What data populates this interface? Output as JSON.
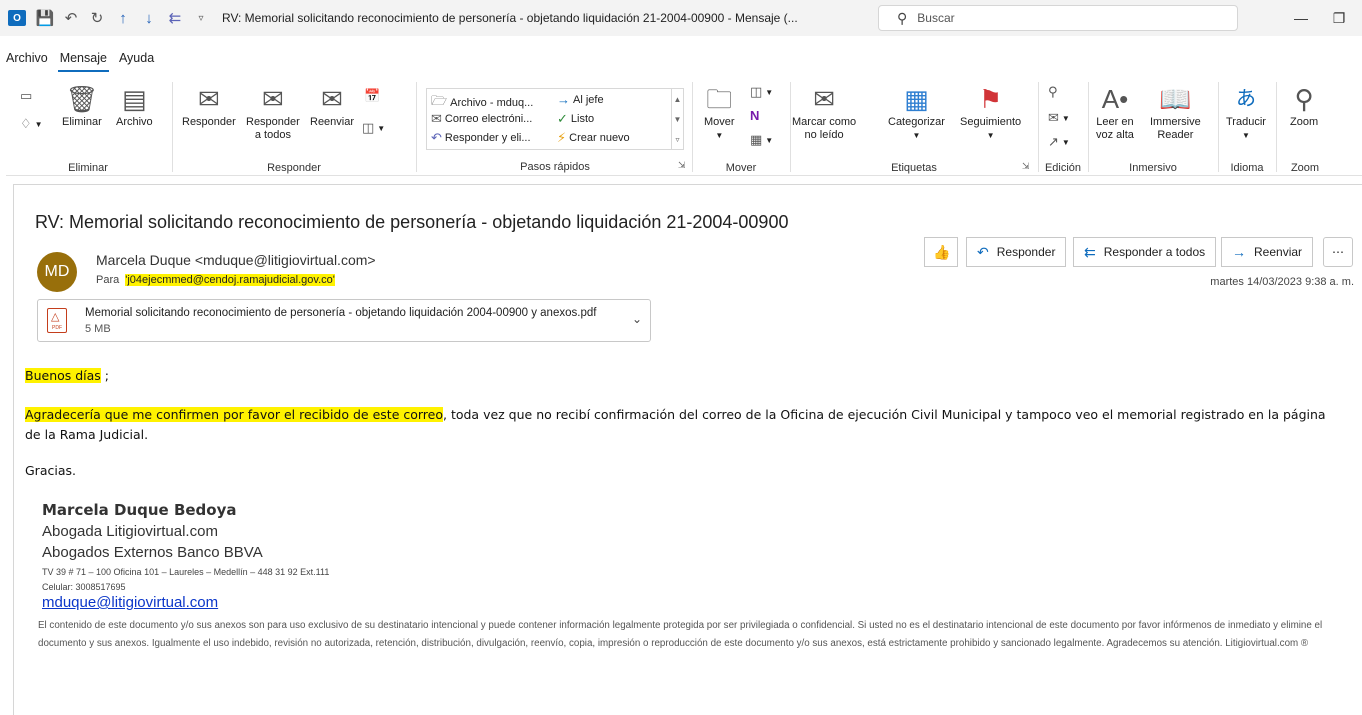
{
  "titlebar": {
    "app_icon": "O",
    "title": "RV: Memorial solicitando reconocimiento de personería - objetando liquidación 21-2004-00900  -  Mensaje (...",
    "search_placeholder": "Buscar"
  },
  "menu": [
    "Archivo",
    "Mensaje",
    "Ayuda"
  ],
  "ribbon": {
    "eliminar": {
      "label": "Eliminar",
      "eliminar_btn": "Eliminar",
      "archivo_btn": "Archivo"
    },
    "responder": {
      "label": "Responder",
      "responder_btn": "Responder",
      "responder_todos_1": "Responder",
      "responder_todos_2": "a todos",
      "reenviar_btn": "Reenviar"
    },
    "pasos": {
      "label": "Pasos rápidos",
      "items": [
        "Archivo - mduq...",
        "Al jefe",
        "Correo electróni...",
        "Listo",
        "Responder y eli...",
        "Crear nuevo"
      ]
    },
    "mover": {
      "label": "Mover",
      "mover_btn": "Mover"
    },
    "etiquetas": {
      "label": "Etiquetas",
      "marcar_1": "Marcar como",
      "marcar_2": "no leído",
      "categorizar": "Categorizar",
      "seguimiento": "Seguimiento"
    },
    "edicion": {
      "label": "Edición"
    },
    "inmersivo": {
      "label": "Inmersivo",
      "leer_1": "Leer en",
      "leer_2": "voz alta",
      "immersive_1": "Immersive",
      "immersive_2": "Reader"
    },
    "idioma": {
      "label": "Idioma",
      "traducir": "Traducir"
    },
    "zoom": {
      "label": "Zoom",
      "zoom_btn": "Zoom"
    }
  },
  "message": {
    "subject": "RV: Memorial solicitando reconocimiento de personería - objetando liquidación 21-2004-00900",
    "avatar_initials": "MD",
    "sender": "Marcela Duque <mduque@litigiovirtual.com>",
    "to_label": "Para",
    "to_value": "'j04ejecmmed@cendoj.ramajudicial.gov.co'",
    "date": "martes 14/03/2023 9:38 a. m.",
    "actions": {
      "responder": "Responder",
      "responder_todos": "Responder a todos",
      "reenviar": "Reenviar"
    },
    "attachment": {
      "name": "Memorial solicitando reconocimiento de personería - objetando liquidación 2004-00900 y anexos.pdf",
      "size": "5 MB",
      "type": "PDF"
    },
    "body": {
      "greeting_hl": "Buenos días",
      "greeting_rest": " ;",
      "p2_hl": "Agradecería que me confirmen por favor el recibido de este correo",
      "p2_rest": ", toda vez que no recibí confirmación del correo de la Oficina de ejecución Civil Municipal y tampoco veo el memorial registrado en la página de la Rama Judicial.",
      "thanks": "Gracias."
    },
    "signature": {
      "name": "Marcela Duque Bedoya",
      "line1": "Abogada Litigiovirtual.com",
      "line2": "Abogados Externos Banco BBVA",
      "address": "TV 39 # 71 – 100 Oficina 101 – Laureles – Medellín – 448 31 92 Ext.111",
      "phone": "Celular: 3008517695",
      "email": "mduque@litigiovirtual.com",
      "disclaimer": "El contenido de este documento y/o sus anexos son para uso exclusivo de su destinatario intencional y puede contener información legalmente protegida por ser privilegiada o confidencial. Si usted no es el destinatario intencional de este documento por favor infórmenos de inmediato y elimine el documento y sus anexos. Igualmente el uso indebido, revisión no autorizada, retención, distribución, divulgación, reenvío, copia, impresión o reproducción de este documento y/o sus anexos, está estrictamente prohibido y sancionado legalmente. Agradecemos su atención. Litigiovirtual.com ®"
    }
  },
  "colors": {
    "accent": "#0f6cbd",
    "highlight": "#fff200",
    "avatar": "#986f0b"
  }
}
